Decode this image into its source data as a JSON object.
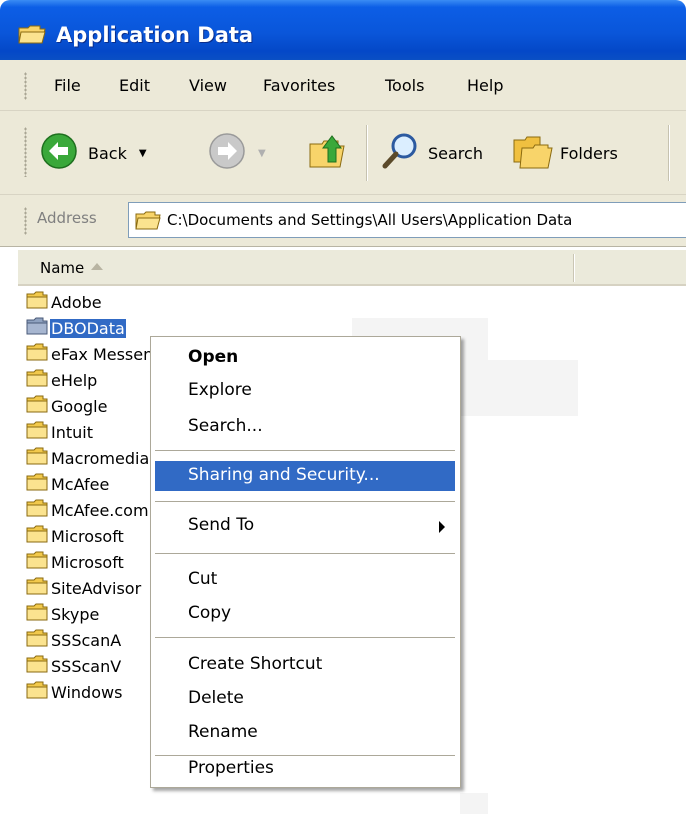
{
  "window": {
    "title": "Application Data"
  },
  "menubar": {
    "items": [
      "File",
      "Edit",
      "View",
      "Favorites",
      "Tools",
      "Help"
    ]
  },
  "toolbar": {
    "back_label": "Back",
    "search_label": "Search",
    "folders_label": "Folders",
    "icons": [
      "back-arrow-icon",
      "forward-arrow-icon",
      "up-folder-icon",
      "search-magnifier-icon",
      "folders-icon"
    ]
  },
  "address": {
    "label": "Address",
    "path": "C:\\Documents and Settings\\All Users\\Application Data"
  },
  "list": {
    "column_name": "Name",
    "items": [
      "Adobe",
      "DBOData",
      "eFax Messenger",
      "eHelp",
      "Google",
      "Intuit",
      "Macromedia",
      "McAfee",
      "McAfee.com",
      "Microsoft",
      "Microsoft",
      "SiteAdvisor",
      "Skype",
      "SSScanA",
      "SSScanV",
      "Windows"
    ],
    "selected": "DBOData"
  },
  "context_menu": {
    "open": "Open",
    "explore": "Explore",
    "search": "Search...",
    "sharing": "Sharing and Security...",
    "send_to": "Send To",
    "cut": "Cut",
    "copy": "Copy",
    "create_shortcut": "Create Shortcut",
    "delete": "Delete",
    "rename": "Rename",
    "properties": "Properties"
  },
  "colors": {
    "titlebar": "#0a56da",
    "selection": "#316ac5",
    "chrome": "#ece9d8",
    "folder": "#f2c94c"
  }
}
